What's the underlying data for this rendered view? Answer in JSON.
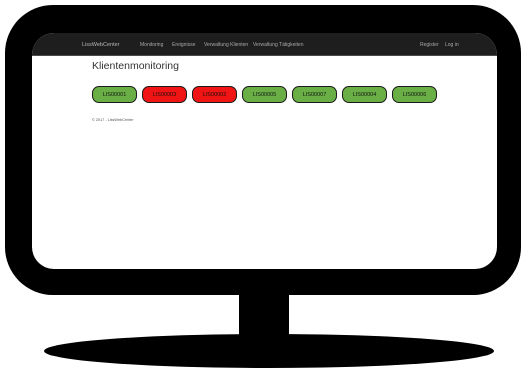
{
  "navbar": {
    "brand": "LissWebCenter",
    "items": [
      "Monitoring",
      "Ereignisse",
      "Verwaltung Klienten",
      "Verwaltung Tätigkeiten"
    ],
    "register": "Register",
    "login": "Log in"
  },
  "page": {
    "title": "Klientenmonitoring"
  },
  "clients": [
    {
      "label": "LIS00001",
      "status_color": "#6aaf46"
    },
    {
      "label": "LIS00003",
      "status_color": "#f01414"
    },
    {
      "label": "LIS00002",
      "status_color": "#f01414"
    },
    {
      "label": "LIS00005",
      "status_color": "#6aaf46"
    },
    {
      "label": "LIS00007",
      "status_color": "#6aaf46"
    },
    {
      "label": "LIS00004",
      "status_color": "#6aaf46"
    },
    {
      "label": "LIS00006",
      "status_color": "#6aaf46"
    }
  ],
  "footer": {
    "text": "© 2017 - LissWebCenter"
  },
  "colors": {
    "ok": "#6aaf46",
    "alarm": "#f01414",
    "navbar_bg": "#1e1e1e",
    "monitor": "#000000"
  }
}
